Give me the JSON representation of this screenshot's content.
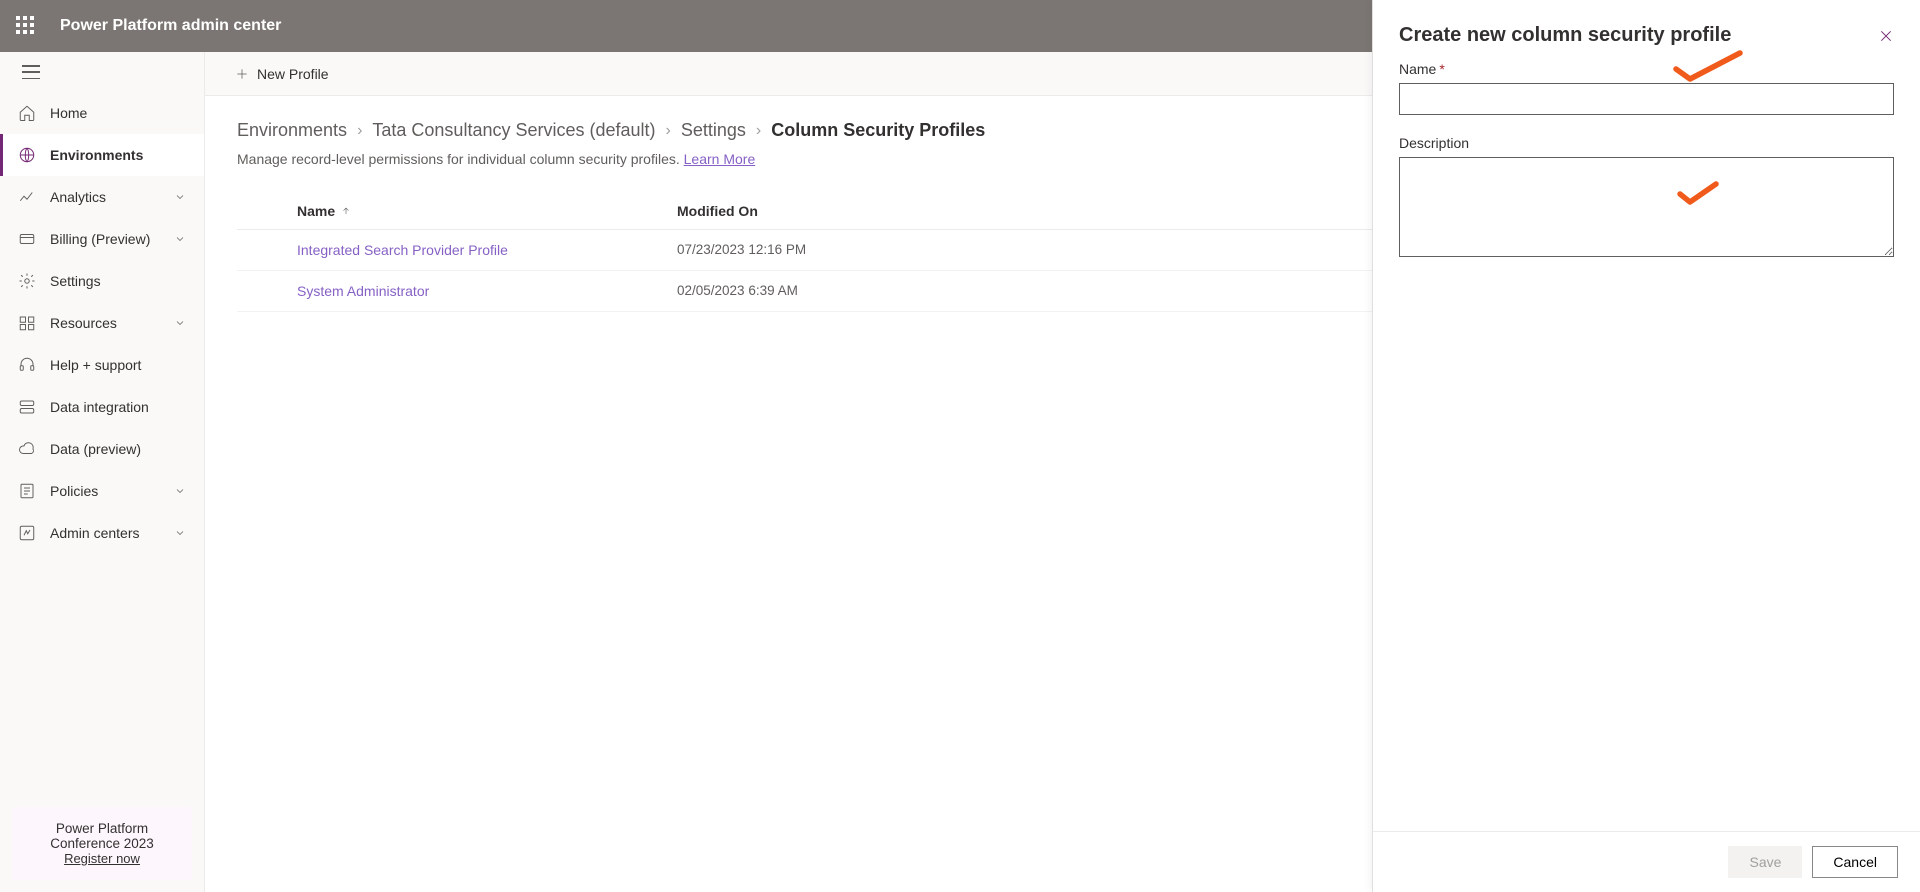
{
  "header": {
    "title": "Power Platform admin center"
  },
  "sidebar": {
    "items": [
      {
        "label": "Home"
      },
      {
        "label": "Environments"
      },
      {
        "label": "Analytics"
      },
      {
        "label": "Billing (Preview)"
      },
      {
        "label": "Settings"
      },
      {
        "label": "Resources"
      },
      {
        "label": "Help + support"
      },
      {
        "label": "Data integration"
      },
      {
        "label": "Data (preview)"
      },
      {
        "label": "Policies"
      },
      {
        "label": "Admin centers"
      }
    ],
    "promo": {
      "line1": "Power Platform",
      "line2": "Conference 2023",
      "link": "Register now"
    }
  },
  "commandbar": {
    "new_profile": "New Profile"
  },
  "breadcrumb": {
    "items": [
      "Environments",
      "Tata Consultancy Services (default)",
      "Settings"
    ],
    "current": "Column Security Profiles"
  },
  "subtext": {
    "text": "Manage record-level permissions for individual column security profiles. ",
    "link": "Learn More"
  },
  "table": {
    "columns": {
      "name": "Name",
      "modified": "Modified On"
    },
    "rows": [
      {
        "name": "Integrated Search Provider Profile",
        "modified": "07/23/2023 12:16 PM"
      },
      {
        "name": "System Administrator",
        "modified": "02/05/2023 6:39 AM"
      }
    ]
  },
  "panel": {
    "title": "Create new column security profile",
    "name_label": "Name",
    "description_label": "Description",
    "save": "Save",
    "cancel": "Cancel"
  }
}
